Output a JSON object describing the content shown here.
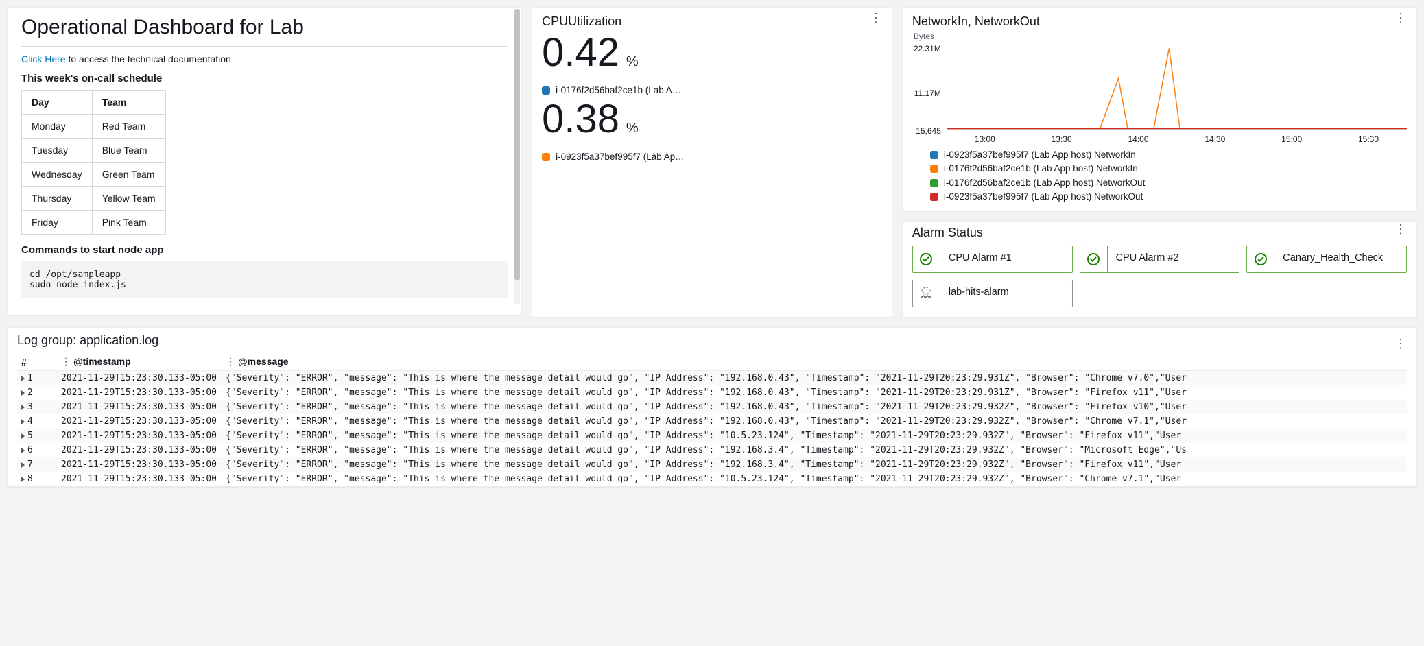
{
  "doc": {
    "title": "Operational Dashboard for Lab",
    "link_text": "Click Here",
    "link_suffix": " to access the technical documentation",
    "schedule_heading": "This week's on-call schedule",
    "schedule_headers": {
      "day": "Day",
      "team": "Team"
    },
    "schedule": [
      {
        "day": "Monday",
        "team": "Red Team"
      },
      {
        "day": "Tuesday",
        "team": "Blue Team"
      },
      {
        "day": "Wednesday",
        "team": "Green Team"
      },
      {
        "day": "Thursday",
        "team": "Yellow Team"
      },
      {
        "day": "Friday",
        "team": "Pink Team"
      }
    ],
    "commands_heading": "Commands to start node app",
    "commands": "cd /opt/sampleapp\nsudo node index.js"
  },
  "cpu": {
    "title": "CPUUtilization",
    "pct_sym": "%",
    "series": [
      {
        "value": "0.42",
        "label": "i-0176f2d56baf2ce1b (Lab A…",
        "color": "#1f77b4"
      },
      {
        "value": "0.38",
        "label": "i-0923f5a37bef995f7 (Lab Ap…",
        "color": "#ff7f0e"
      }
    ]
  },
  "network": {
    "title": "NetworkIn, NetworkOut",
    "ylabel": "Bytes",
    "legend": [
      {
        "label": "i-0923f5a37bef995f7 (Lab App host) NetworkIn",
        "color": "#1f77b4"
      },
      {
        "label": "i-0176f2d56baf2ce1b (Lab App host) NetworkIn",
        "color": "#ff7f0e"
      },
      {
        "label": "i-0176f2d56baf2ce1b (Lab App host) NetworkOut",
        "color": "#2ca02c"
      },
      {
        "label": "i-0923f5a37bef995f7 (Lab App host) NetworkOut",
        "color": "#d62728"
      }
    ]
  },
  "chart_data": {
    "type": "line",
    "title": "NetworkIn, NetworkOut",
    "ylabel": "Bytes",
    "ylim": [
      15645,
      22310000
    ],
    "yticks": [
      "22.31M",
      "11.17M",
      "15,645"
    ],
    "xticks": [
      "13:00",
      "13:30",
      "14:00",
      "14:30",
      "15:00",
      "15:30"
    ],
    "series": [
      {
        "name": "i-0923f5a37bef995f7 (Lab App host) NetworkIn",
        "color": "#1f77b4",
        "points": [
          [
            0,
            15645
          ],
          [
            60,
            15645
          ],
          [
            120,
            15645
          ],
          [
            180,
            15645
          ],
          [
            240,
            15645
          ],
          [
            300,
            15645
          ]
        ]
      },
      {
        "name": "i-0176f2d56baf2ce1b (Lab App host) NetworkIn",
        "color": "#ff7f0e",
        "points": [
          [
            0,
            15645
          ],
          [
            100,
            15645
          ],
          [
            112,
            14000000
          ],
          [
            118,
            15645
          ],
          [
            135,
            15645
          ],
          [
            145,
            22310000
          ],
          [
            152,
            15645
          ],
          [
            300,
            15645
          ]
        ]
      },
      {
        "name": "i-0176f2d56baf2ce1b (Lab App host) NetworkOut",
        "color": "#2ca02c",
        "points": [
          [
            0,
            15645
          ],
          [
            300,
            15645
          ]
        ]
      },
      {
        "name": "i-0923f5a37bef995f7 (Lab App host) NetworkOut",
        "color": "#d62728",
        "points": [
          [
            0,
            15645
          ],
          [
            300,
            15645
          ]
        ]
      }
    ]
  },
  "alarms": {
    "title": "Alarm Status",
    "items": [
      {
        "label": "CPU Alarm #1",
        "state": "ok"
      },
      {
        "label": "CPU Alarm #2",
        "state": "ok"
      },
      {
        "label": "Canary_Health_Check",
        "state": "ok"
      },
      {
        "label": "lab-hits-alarm",
        "state": "insufficient"
      }
    ]
  },
  "logs": {
    "title": "Log group: application.log",
    "columns": {
      "num": "#",
      "ts": "@timestamp",
      "msg": "@message"
    },
    "rows": [
      {
        "n": "1",
        "ts": "2021-11-29T15:23:30.133-05:00",
        "msg": "{\"Severity\": \"ERROR\", \"message\": \"This is where the message detail would go\", \"IP Address\": \"192.168.0.43\", \"Timestamp\": \"2021-11-29T20:23:29.931Z\", \"Browser\": \"Chrome v7.0\",\"User"
      },
      {
        "n": "2",
        "ts": "2021-11-29T15:23:30.133-05:00",
        "msg": "{\"Severity\": \"ERROR\", \"message\": \"This is where the message detail would go\", \"IP Address\": \"192.168.0.43\", \"Timestamp\": \"2021-11-29T20:23:29.931Z\", \"Browser\": \"Firefox v11\",\"User"
      },
      {
        "n": "3",
        "ts": "2021-11-29T15:23:30.133-05:00",
        "msg": "{\"Severity\": \"ERROR\", \"message\": \"This is where the message detail would go\", \"IP Address\": \"192.168.0.43\", \"Timestamp\": \"2021-11-29T20:23:29.932Z\", \"Browser\": \"Firefox v10\",\"User"
      },
      {
        "n": "4",
        "ts": "2021-11-29T15:23:30.133-05:00",
        "msg": "{\"Severity\": \"ERROR\", \"message\": \"This is where the message detail would go\", \"IP Address\": \"192.168.0.43\", \"Timestamp\": \"2021-11-29T20:23:29.932Z\", \"Browser\": \"Chrome v7.1\",\"User"
      },
      {
        "n": "5",
        "ts": "2021-11-29T15:23:30.133-05:00",
        "msg": "{\"Severity\": \"ERROR\", \"message\": \"This is where the message detail would go\", \"IP Address\": \"10.5.23.124\", \"Timestamp\": \"2021-11-29T20:23:29.932Z\", \"Browser\": \"Firefox v11\",\"User"
      },
      {
        "n": "6",
        "ts": "2021-11-29T15:23:30.133-05:00",
        "msg": "{\"Severity\": \"ERROR\", \"message\": \"This is where the message detail would go\", \"IP Address\": \"192.168.3.4\", \"Timestamp\": \"2021-11-29T20:23:29.932Z\", \"Browser\": \"Microsoft Edge\",\"Us"
      },
      {
        "n": "7",
        "ts": "2021-11-29T15:23:30.133-05:00",
        "msg": "{\"Severity\": \"ERROR\", \"message\": \"This is where the message detail would go\", \"IP Address\": \"192.168.3.4\", \"Timestamp\": \"2021-11-29T20:23:29.932Z\", \"Browser\": \"Firefox v11\",\"User "
      },
      {
        "n": "8",
        "ts": "2021-11-29T15:23:30.133-05:00",
        "msg": "{\"Severity\": \"ERROR\", \"message\": \"This is where the message detail would go\", \"IP Address\": \"10.5.23.124\", \"Timestamp\": \"2021-11-29T20:23:29.932Z\", \"Browser\": \"Chrome v7.1\",\"User"
      }
    ]
  }
}
